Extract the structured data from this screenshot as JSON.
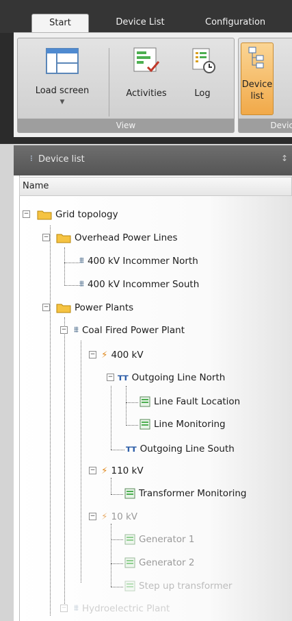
{
  "tabs": [
    {
      "label": "Start",
      "active": true
    },
    {
      "label": "Device List",
      "active": false
    },
    {
      "label": "Configuration",
      "active": false
    }
  ],
  "ribbon": {
    "view_group": {
      "label": "View",
      "buttons": [
        {
          "label": "Load screen",
          "icon": "load-screen-icon",
          "has_dropdown": true
        },
        {
          "label": "Activities",
          "icon": "activities-icon"
        },
        {
          "label": "Log",
          "icon": "log-icon"
        }
      ]
    },
    "device_group": {
      "label": "Devic",
      "button": {
        "label_line1": "Device",
        "label_line2": "list",
        "icon": "device-list-icon",
        "active": true
      }
    }
  },
  "panel": {
    "title": "Device list",
    "pin_glyph": "↕",
    "column_header": "Name"
  },
  "tree": [
    {
      "label": "Grid topology",
      "icon": "folder-icon",
      "expander": "−"
    },
    {
      "label": "Overhead Power Lines",
      "icon": "folder-icon",
      "expander": "−"
    },
    {
      "label": "400 kV Incommer North",
      "icon": "power-line-icon"
    },
    {
      "label": "400 kV Incommer South",
      "icon": "power-line-icon"
    },
    {
      "label": "Power Plants",
      "icon": "folder-icon",
      "expander": "−"
    },
    {
      "label": "Coal Fired Power Plant",
      "icon": "power-line-icon",
      "expander": "−"
    },
    {
      "label": "400 kV",
      "icon": "voltage-bolt-icon",
      "expander": "−"
    },
    {
      "label": "Outgoing Line North",
      "icon": "outgoing-line-icon",
      "expander": "−"
    },
    {
      "label": "Line Fault Location",
      "icon": "monitor-screen-icon"
    },
    {
      "label": "Line Monitoring",
      "icon": "monitor-screen-icon"
    },
    {
      "label": "Outgoing Line South",
      "icon": "outgoing-line-icon"
    },
    {
      "label": "110 kV",
      "icon": "voltage-bolt-icon",
      "expander": "−"
    },
    {
      "label": "Transformer Monitoring",
      "icon": "monitor-screen-icon"
    },
    {
      "label": "10 kV",
      "icon": "voltage-bolt-icon",
      "expander": "−"
    },
    {
      "label": "Generator 1",
      "icon": "monitor-screen-icon"
    },
    {
      "label": "Generator 2",
      "icon": "monitor-screen-icon"
    },
    {
      "label": "Step up transformer",
      "icon": "monitor-screen-icon"
    },
    {
      "label": "Hydroelectric Plant",
      "icon": "power-line-icon",
      "expander": "−"
    }
  ],
  "colors": {
    "accent_active": "#f1a949",
    "ribbon_dark": "#2b2b2b",
    "folder": "#f5c342"
  }
}
